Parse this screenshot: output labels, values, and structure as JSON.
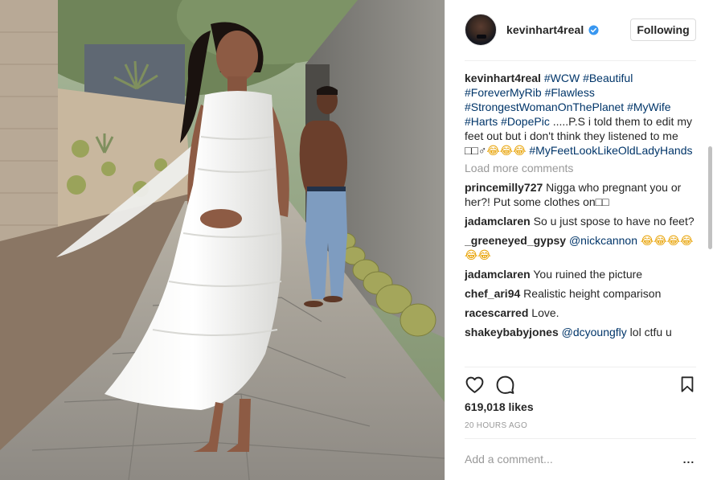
{
  "post": {
    "username": "kevinhart4real",
    "follow_label": "Following",
    "caption": {
      "user": "kevinhart4real",
      "segments": [
        {
          "type": "tag",
          "text": "#WCW"
        },
        {
          "type": "text",
          "text": " "
        },
        {
          "type": "tag",
          "text": "#Beautiful"
        },
        {
          "type": "text",
          "text": " "
        },
        {
          "type": "tag",
          "text": "#ForeverMyRib"
        },
        {
          "type": "text",
          "text": " "
        },
        {
          "type": "tag",
          "text": "#Flawless"
        },
        {
          "type": "text",
          "text": " "
        },
        {
          "type": "tag",
          "text": "#StrongestWomanOnThePlanet"
        },
        {
          "type": "text",
          "text": " "
        },
        {
          "type": "tag",
          "text": "#MyWife"
        },
        {
          "type": "text",
          "text": " "
        },
        {
          "type": "tag",
          "text": "#Harts"
        },
        {
          "type": "text",
          "text": " "
        },
        {
          "type": "tag",
          "text": "#DopePic"
        },
        {
          "type": "text",
          "text": " .....P.S i told them to edit my feet out but i don't think they listened to me □□♂"
        },
        {
          "type": "emoji",
          "text": "😂😂😂"
        },
        {
          "type": "text",
          "text": " "
        },
        {
          "type": "tag",
          "text": "#MyFeetLookLikeOldLadyHands"
        }
      ]
    },
    "load_more_label": "Load more comments",
    "comments": [
      {
        "user": "princemilly727",
        "segments": [
          {
            "type": "text",
            "text": "Nigga who pregnant you or her?! Put some clothes on□□"
          }
        ]
      },
      {
        "user": "jadamclaren",
        "segments": [
          {
            "type": "text",
            "text": "So u just spose to have no feet?"
          }
        ]
      },
      {
        "user": "_greeneyed_gypsy",
        "segments": [
          {
            "type": "tag",
            "text": "@nickcannon"
          },
          {
            "type": "text",
            "text": " "
          },
          {
            "type": "emoji",
            "text": "😂😂😂😂😂😂"
          }
        ]
      },
      {
        "user": "jadamclaren",
        "segments": [
          {
            "type": "text",
            "text": "You ruined the picture"
          }
        ]
      },
      {
        "user": "chef_ari94",
        "segments": [
          {
            "type": "text",
            "text": "Realistic height comparison"
          }
        ]
      },
      {
        "user": "racescarred",
        "segments": [
          {
            "type": "text",
            "text": "Love."
          }
        ]
      },
      {
        "user": "shakeybabyjones",
        "segments": [
          {
            "type": "tag",
            "text": "@dcyoungfly"
          },
          {
            "type": "text",
            "text": " lol ctfu u"
          }
        ]
      }
    ],
    "likes": "619,018 likes",
    "timestamp": "20 HOURS AGO",
    "add_comment_placeholder": "Add a comment...",
    "more_label": "..."
  },
  "icons": {
    "verified": "verified-badge-icon",
    "like": "heart-icon",
    "comment": "comment-bubble-icon",
    "save": "bookmark-icon",
    "more": "more-options-icon"
  },
  "colors": {
    "hashtag": "#003569",
    "verified": "#3897f0",
    "muted": "#999999",
    "text": "#262626"
  }
}
